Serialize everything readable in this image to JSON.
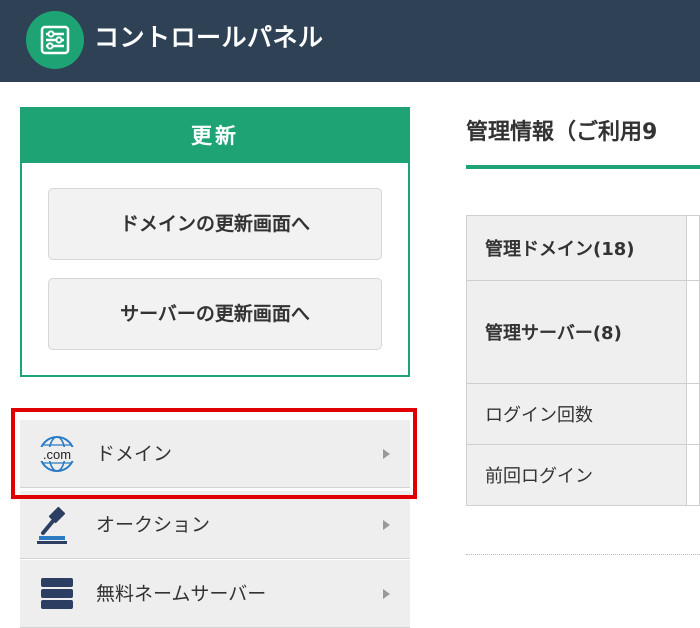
{
  "header": {
    "title": "コントロールパネル",
    "logo_icon": "control-panel-sliders-icon",
    "background": "#2e4155",
    "accent": "#1ea474"
  },
  "renewal": {
    "heading": "更新",
    "domain_button": "ドメインの更新画面へ",
    "server_button": "サーバーの更新画面へ"
  },
  "menu": {
    "items": [
      {
        "label": "ドメイン",
        "icon": "dotcom-globe-icon",
        "highlighted": true
      },
      {
        "label": "オークション",
        "icon": "auction-gavel-icon",
        "highlighted": false
      },
      {
        "label": "無料ネームサーバー",
        "icon": "server-stack-icon",
        "highlighted": false
      }
    ]
  },
  "main": {
    "title": "管理情報（ご利用9",
    "table": [
      {
        "label": "管理ドメイン(18)",
        "value": ""
      },
      {
        "label": "管理サーバー(8)",
        "value": ""
      },
      {
        "label": "ログイン回数",
        "value": ""
      },
      {
        "label": "前回ログイン",
        "value": ""
      }
    ]
  },
  "highlight_color": "#e00000"
}
